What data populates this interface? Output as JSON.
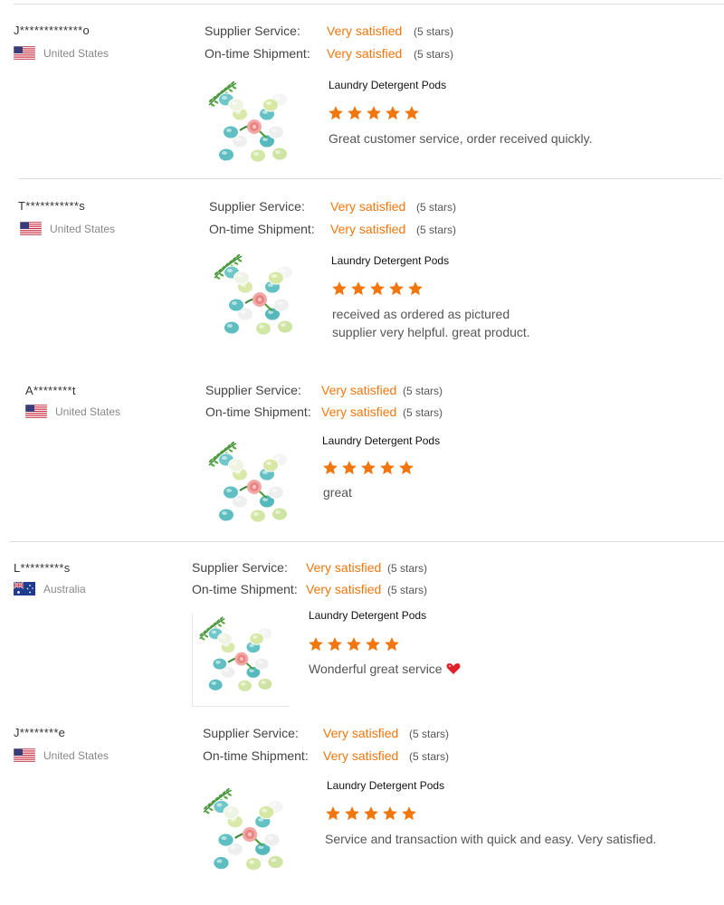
{
  "labels": {
    "supplier_service": "Supplier Service:",
    "on_time_shipment": "On-time Shipment:",
    "very_satisfied": "Very satisfied",
    "five_stars": "(5 stars)"
  },
  "colors": {
    "accent": "#f2760e",
    "muted": "#888888"
  },
  "icons": {
    "flag_us": "us-flag-icon",
    "flag_au": "au-flag-icon",
    "star": "star-icon",
    "heart": "heart-icon"
  },
  "reviews": [
    {
      "buyer": "J*************o",
      "country": "United States",
      "product": "Laundry Detergent Pods",
      "rating": 5,
      "comment": [
        "Great customer service, order received quickly."
      ]
    },
    {
      "buyer": "T***********s",
      "country": "United States",
      "product": "Laundry Detergent Pods",
      "rating": 5,
      "comment": [
        "received as ordered as pictured",
        "supplier very helpful. great product."
      ]
    },
    {
      "buyer": "A********t",
      "country": "United States",
      "product": "Laundry Detergent Pods",
      "rating": 5,
      "comment": [
        "great"
      ]
    },
    {
      "buyer": "L*********s",
      "country": "Australia",
      "product": "Laundry Detergent Pods",
      "rating": 5,
      "comment": [
        "Wonderful great service"
      ]
    },
    {
      "buyer": "J********e",
      "country": "United States",
      "product": "Laundry Detergent Pods",
      "rating": 5,
      "comment": [
        "Service and transaction with quick and easy. Very satisfied."
      ]
    }
  ]
}
